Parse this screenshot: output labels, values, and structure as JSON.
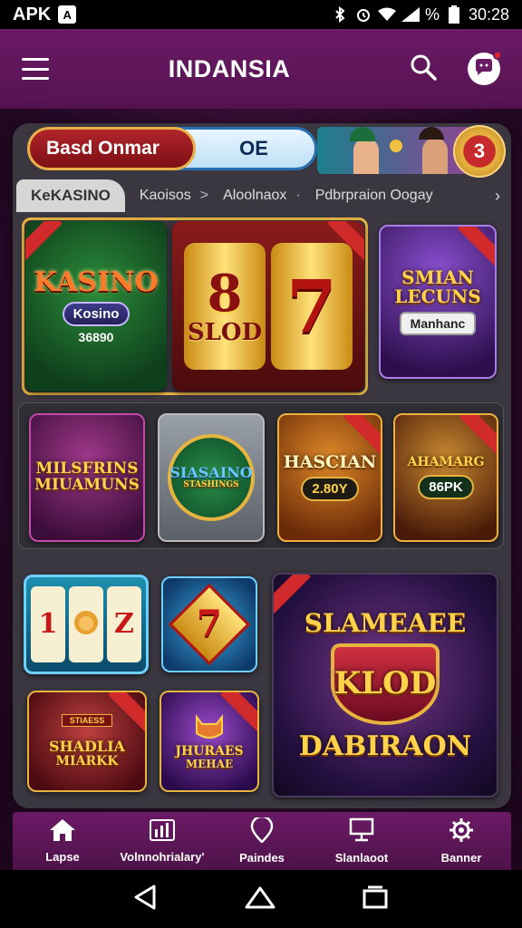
{
  "status_bar": {
    "left_label": "APK",
    "app_badge": "A",
    "percent": "%",
    "time": "30:28"
  },
  "app_bar": {
    "title": "INDANSIA"
  },
  "banner": {
    "left_pill": "Basd Onmar",
    "right_pill": "OE",
    "badge_number": "3"
  },
  "breadcrumb": {
    "tab": "KeKASINO",
    "items": [
      "Kaoisos",
      "Aloolnaox",
      "Pdbrpraion Oogay"
    ],
    "separators": [
      ">",
      "·"
    ]
  },
  "tiles": {
    "kasino": {
      "logo": "KASINO",
      "tag": "Kosino",
      "num": "36890"
    },
    "slod": {
      "logo": "SLOD",
      "big_digits": "8",
      "big_seven": "7"
    },
    "smian": {
      "logo_line1": "SMIAN",
      "logo_line2": "LECUNS",
      "tag": "Manhanc"
    },
    "milsfrins": {
      "logo_line1": "MILSFRINS",
      "logo_line2": "MIUAMUNS"
    },
    "sasaino": {
      "logo_line1": "SIASAINO",
      "logo_line2": "STASHINGS"
    },
    "hascian": {
      "logo": "HASCIAN",
      "tag": "2.80Y"
    },
    "lion": {
      "logo": "AHAMARG",
      "tag": "86PK"
    },
    "reels": {
      "reel1": "1",
      "reel3": "Z"
    },
    "seven": {
      "digit": "7"
    },
    "stiarda": {
      "top": "STIAESS",
      "logo_line1": "SHADLIA",
      "logo_line2": "MIARKK"
    },
    "cat": {
      "logo_line1": "JHURAES",
      "logo_line2": "MEHAE"
    },
    "big": {
      "line1": "SLAMEAEE",
      "line2": "KLOD",
      "line3": "DABIRAON"
    }
  },
  "bottom_nav": {
    "items": [
      {
        "label": "Lapse",
        "icon": "home-icon"
      },
      {
        "label": "Volnnohrialary'",
        "icon": "chart-icon"
      },
      {
        "label": "Paindes",
        "icon": "location-icon"
      },
      {
        "label": "Slanlaoot",
        "icon": "monitor-icon"
      },
      {
        "label": "Banner",
        "icon": "gear-icon"
      }
    ]
  },
  "colors": {
    "app_bar": "#6b1a66",
    "panel": "#3a3740",
    "gold": "#ffd24a",
    "accent_red": "#d02a2a"
  }
}
